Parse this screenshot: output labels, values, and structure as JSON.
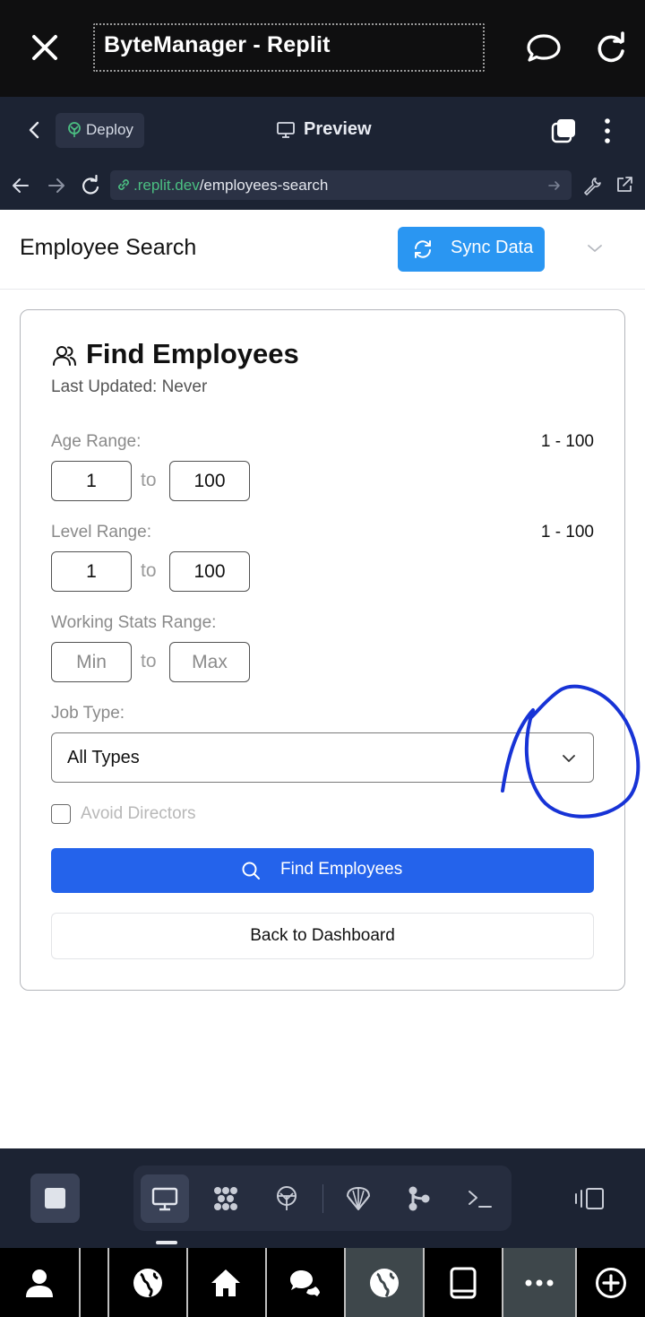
{
  "browser": {
    "title": "ByteManager - Replit",
    "close_icon": "close-icon",
    "chat_icon": "chat-bubble-icon",
    "reload_icon": "reload-icon"
  },
  "replit": {
    "deploy_label": "Deploy",
    "preview_label": "Preview",
    "url_domain": ".replit.dev",
    "url_path": "/employees-search"
  },
  "app": {
    "header_title": "Employee Search",
    "sync_label": "Sync Data",
    "accent": "#2a96f2"
  },
  "card": {
    "title": "Find Employees",
    "last_updated": "Last Updated: Never",
    "age": {
      "label": "Age Range:",
      "range_text": "1 - 100",
      "min": "1",
      "to": "to",
      "max": "100"
    },
    "level": {
      "label": "Level Range:",
      "range_text": "1 - 100",
      "min": "1",
      "to": "to",
      "max": "100"
    },
    "working": {
      "label": "Working Stats Range:",
      "min_placeholder": "Min",
      "to": "to",
      "max_placeholder": "Max"
    },
    "job_type": {
      "label": "Job Type:",
      "selected": "All Types"
    },
    "avoid_directors_label": "Avoid Directors",
    "find_button": "Find Employees",
    "back_button": "Back to Dashboard",
    "primary_color": "#2463eb"
  },
  "toolbar": {
    "icons": [
      "monitor-icon",
      "modules-icon",
      "deploy-icon",
      "shell-icon",
      "git-icon",
      "console-icon"
    ],
    "panels_icon": "panels-icon"
  },
  "system_nav": {
    "icons": [
      "person-icon",
      "globe-icon",
      "home-icon",
      "chat-icon",
      "globe-icon",
      "tablet-icon",
      "more-icon",
      "add-icon"
    ]
  }
}
